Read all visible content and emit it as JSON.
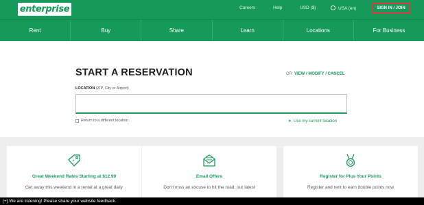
{
  "header": {
    "logo_text": "enterprise",
    "utility_links": [
      "Careers",
      "Help",
      "USD ($)",
      "USA (en)"
    ],
    "signin_label": "SIGN IN / JOIN",
    "brand_color": "#169a5a",
    "highlight_color": "#d83b3b"
  },
  "nav": {
    "items": [
      "Rent",
      "Buy",
      "Share",
      "Learn",
      "Locations",
      "For Business"
    ]
  },
  "reservation": {
    "title": "START A RESERVATION",
    "or_text": "OR",
    "view_modify_link": "VIEW / MODIFY / CANCEL",
    "location_label": "LOCATION",
    "location_hint": "(ZIP, City or Airport)",
    "location_value": "",
    "return_label": "Return to a different location",
    "use_location_label": "Use my current location"
  },
  "promos": [
    {
      "icon": "tag-icon",
      "title": "Great Weekend Rates Starting at $12.99",
      "desc": "Get away this weekend in a rental at a great daily"
    },
    {
      "icon": "envelope-icon",
      "title": "Email Offers",
      "desc": "Don't miss an excuse to hit the road: our latest"
    },
    {
      "icon": "medal-icon",
      "title": "Register for Plus Your Points",
      "desc": "Register and rent to earn double points now"
    }
  ],
  "feedback": {
    "text": "[+] We are listening! Please share your website feedback."
  }
}
